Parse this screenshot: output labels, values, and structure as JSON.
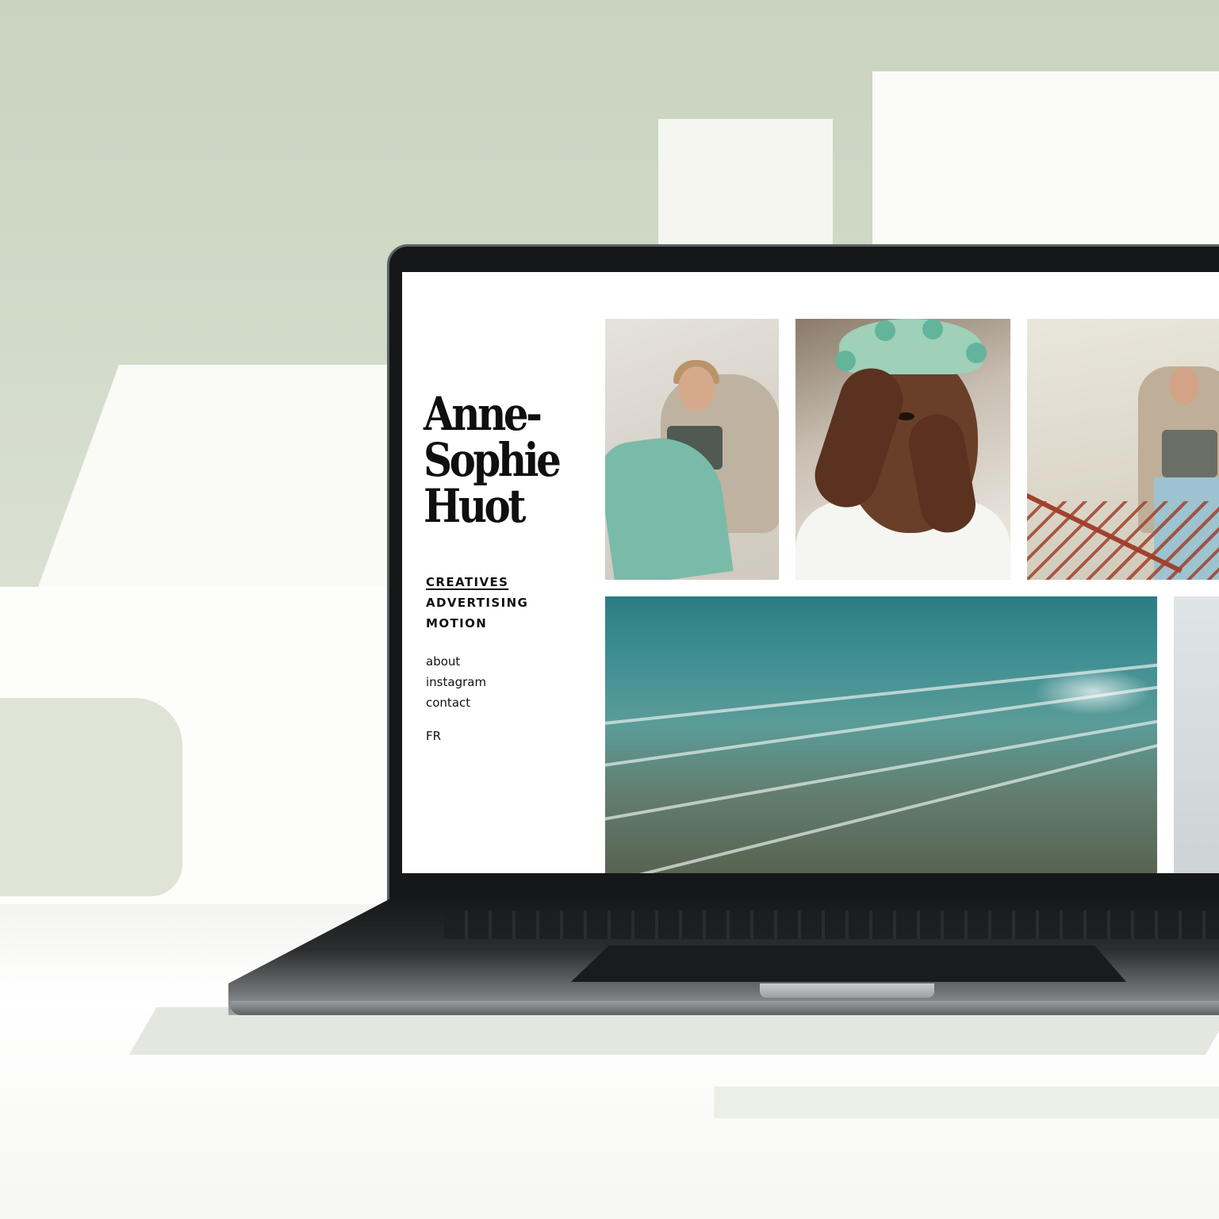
{
  "site": {
    "name_lines": [
      "Anne-",
      "Sophie",
      "Huot"
    ]
  },
  "nav": {
    "primary": [
      {
        "label": "CREATIVES",
        "active": true
      },
      {
        "label": "ADVERTISING",
        "active": false
      },
      {
        "label": "MOTION",
        "active": false
      }
    ],
    "secondary": [
      {
        "label": "about"
      },
      {
        "label": "instagram"
      },
      {
        "label": "contact"
      }
    ],
    "language": "FR"
  },
  "gallery": {
    "items": [
      {
        "subject": "woman in jacket and jeans leaning on wall"
      },
      {
        "subject": "portrait with green hair knots and hands on face"
      },
      {
        "subject": "woman by red railing"
      },
      {
        "subject": "sea waves on shore"
      },
      {
        "subject": "partially visible grey image"
      }
    ]
  },
  "colors": {
    "text": "#111111",
    "screen_bg": "#ffffff",
    "wall": "#d3dbca",
    "laptop_frame": "#161718"
  }
}
